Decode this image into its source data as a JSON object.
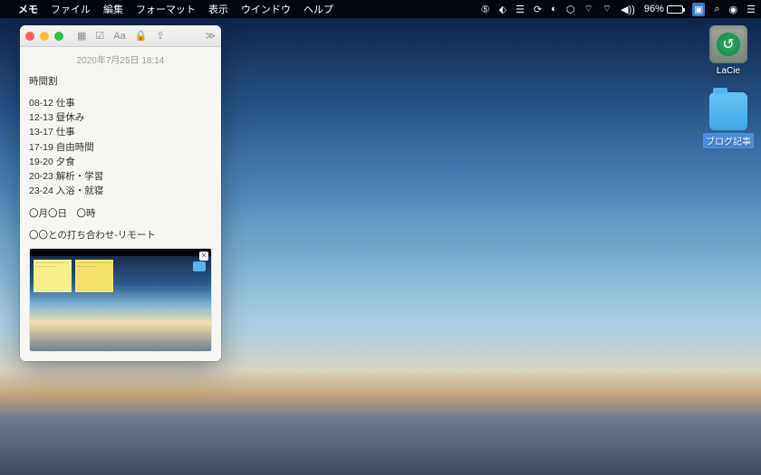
{
  "menubar": {
    "app": "メモ",
    "items": [
      "ファイル",
      "編集",
      "フォーマット",
      "表示",
      "ウインドウ",
      "ヘルプ"
    ],
    "battery_pct": "96%"
  },
  "desktop": {
    "drive_label": "LaCie",
    "folder_label": "ブログ記事"
  },
  "note": {
    "date": "2020年7月25日 18:14",
    "title": "時間割",
    "schedule": [
      "08-12 仕事",
      "12-13 昼休み",
      "13-17 仕事",
      "17-19 自由時間",
      "19-20 夕食",
      "20-23 解析・学習",
      "23-24 入浴・就寝"
    ],
    "extra1": "〇月〇日　〇時",
    "extra2": "〇〇との打ち合わせ-リモート"
  }
}
